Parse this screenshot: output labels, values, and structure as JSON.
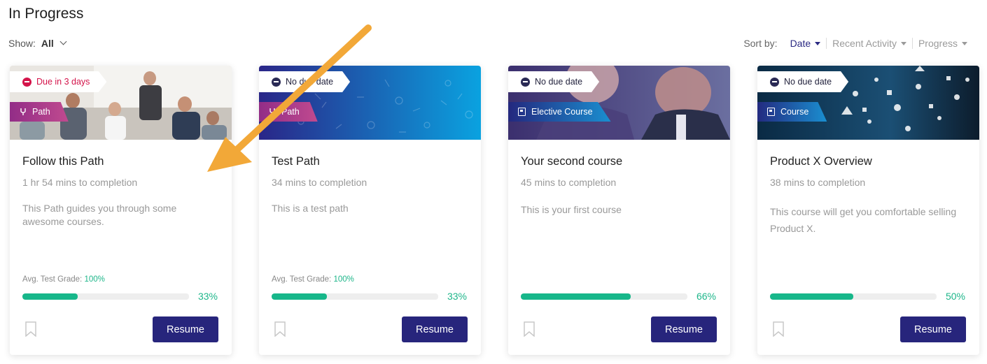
{
  "page": {
    "title": "In Progress"
  },
  "filter": {
    "label": "Show:",
    "value": "All"
  },
  "sort": {
    "label": "Sort by:",
    "options": [
      {
        "label": "Date",
        "active": true
      },
      {
        "label": "Recent Activity",
        "active": false
      },
      {
        "label": "Progress",
        "active": false
      }
    ]
  },
  "colors": {
    "accent": "#27257c",
    "progress": "#17b78a",
    "due_red": "#d4144a"
  },
  "cards": [
    {
      "due": "Due in 3 days",
      "type": "Path",
      "title": "Follow this Path",
      "duration": "1 hr 54 mins to completion",
      "description": "This Path guides you through some awesome courses.",
      "grade_label": "Avg. Test Grade:",
      "grade_value": "100%",
      "progress": 0.33,
      "progress_text": "33%",
      "button": "Resume"
    },
    {
      "due": "No due date",
      "type": "Path",
      "title": "Test Path",
      "duration": "34 mins to completion",
      "description": "This is a test path",
      "grade_label": "Avg. Test Grade:",
      "grade_value": "100%",
      "progress": 0.33,
      "progress_text": "33%",
      "button": "Resume"
    },
    {
      "due": "No due date",
      "type": "Elective Course",
      "title": "Your second course",
      "duration": "45 mins to completion",
      "description": "This is your first course",
      "progress": 0.66,
      "progress_text": "66%",
      "button": "Resume"
    },
    {
      "due": "No due date",
      "type": "Course",
      "title": "Product X Overview",
      "duration": "38 mins to completion",
      "description": "This course will get you comfortable selling Product X.",
      "progress": 0.5,
      "progress_text": "50%",
      "button": "Resume"
    }
  ]
}
